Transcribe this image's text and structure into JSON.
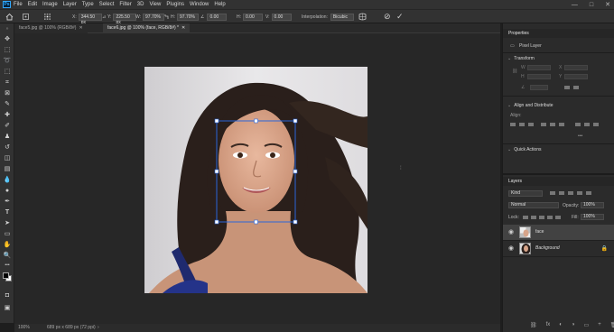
{
  "menu": {
    "logo": "Ps",
    "items": [
      "File",
      "Edit",
      "Image",
      "Layer",
      "Type",
      "Select",
      "Filter",
      "3D",
      "View",
      "Plugins",
      "Window",
      "Help"
    ],
    "window_controls": [
      "—",
      "□",
      "✕"
    ]
  },
  "options": {
    "x_value": "344.50 px",
    "y_value": "225.50 px",
    "w_value": "97.70%",
    "h_value": "97.70%",
    "angle_value": "0.00",
    "h_skew_value": "0.00",
    "v_skew_value": "0.00",
    "interpolation_label": "Interpolation:",
    "interpolation_value": "Bicubic",
    "cancel_glyph": "⊘",
    "commit_glyph": "✓"
  },
  "tabs": [
    {
      "label": "face5.jpg @ 100% (RGB/8#)",
      "close": "✕"
    },
    {
      "label": "face6.jpg @ 100% (face, RGB/8#) *",
      "close": "✕"
    }
  ],
  "status": {
    "zoom": "100%",
    "doc_info": "689 px x 689 px (72 ppi)"
  },
  "properties": {
    "tab_label": "Properties",
    "layer_type": "Pixel Layer",
    "transform_title": "Transform",
    "align_title": "Align and Distribute",
    "align_label": "Align:",
    "quick_actions_title": "Quick Actions",
    "more_glyph": "•••"
  },
  "layers": {
    "tab_label": "Layers",
    "kind_value": "Kind",
    "blend_mode": "Normal",
    "opacity_label": "Opacity:",
    "opacity_value": "100%",
    "lock_label": "Lock:",
    "fill_label": "Fill:",
    "fill_value": "100%",
    "rows": [
      {
        "name": "face",
        "selected": true
      },
      {
        "name": "Background",
        "selected": false
      }
    ],
    "lock_glyph": "🔒"
  },
  "icons": {
    "eye": "◉",
    "bottom": [
      "⛓",
      "fx",
      "◐",
      "◑",
      "▭",
      "+",
      "🗑"
    ]
  },
  "colors": {
    "accent": "#31a8ff",
    "transform_box": "#2b66d9",
    "foreground": "#000000",
    "background": "#ffffff"
  }
}
